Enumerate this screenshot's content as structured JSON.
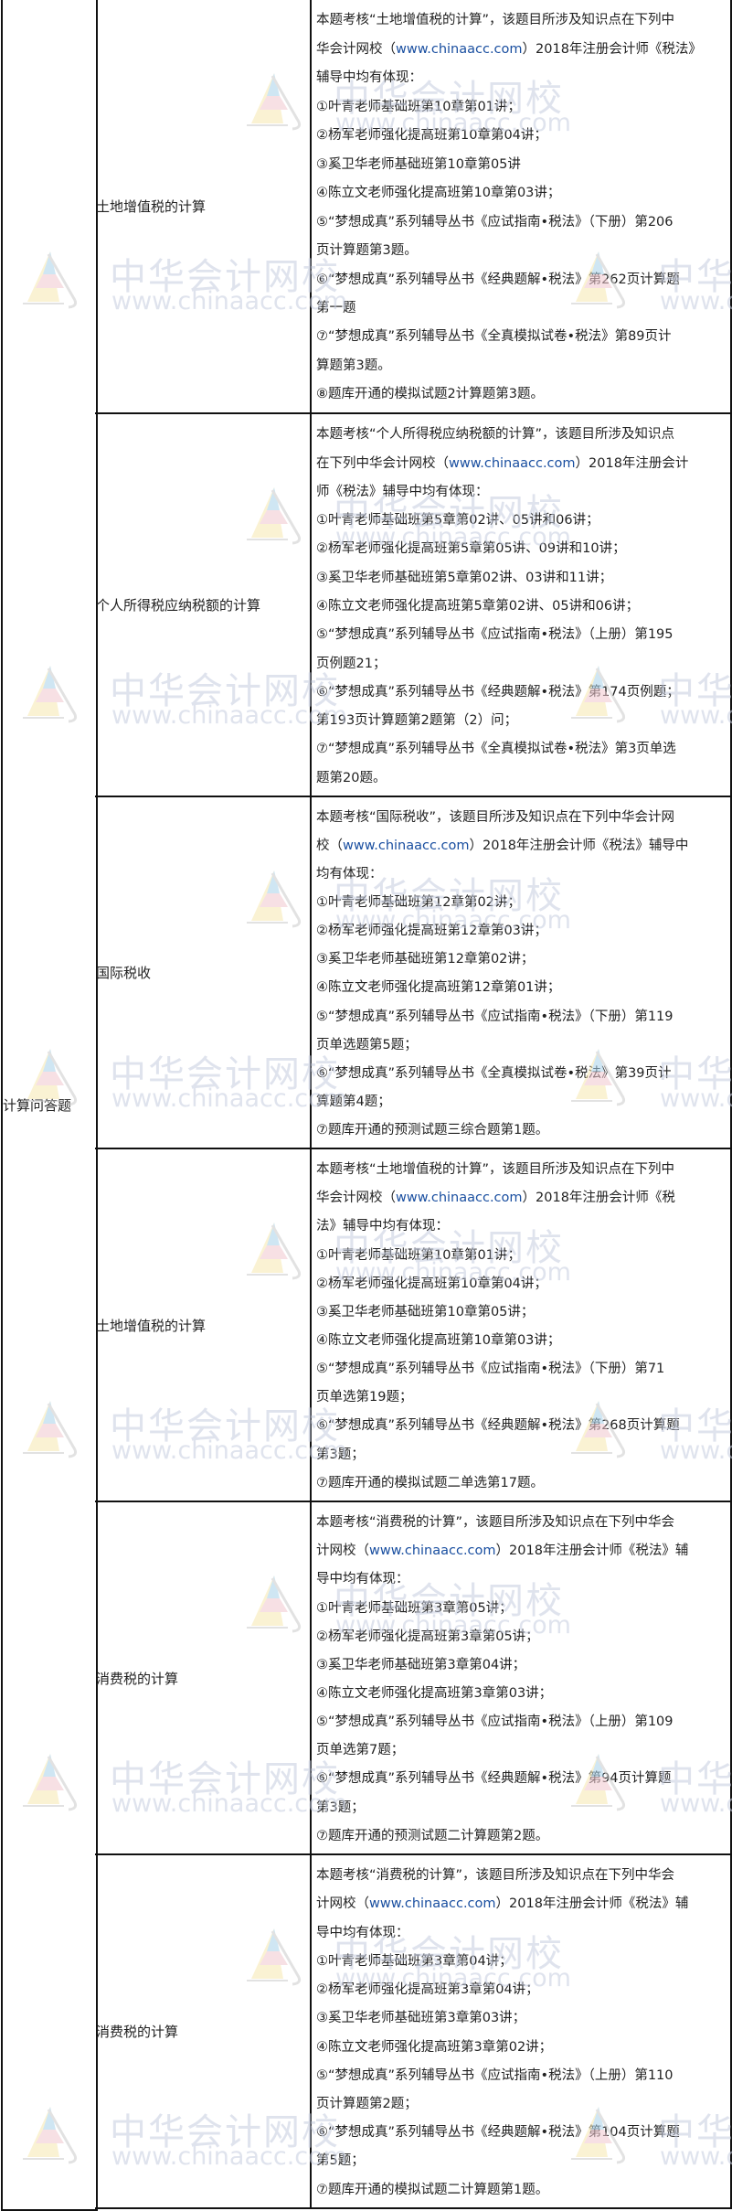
{
  "category": "计算问答题",
  "watermark": {
    "cn": "中华会计网校",
    "url": "www.chinaacc.com"
  },
  "colors": {
    "link": "#1a4fa0",
    "border": "#111111",
    "watermark": "#c6cde0"
  },
  "rows": [
    {
      "topic": "土地增值税的计算",
      "lines": [
        "本题考核“土地增值税的计算”，该题目所涉及知识点在下列中",
        {
          "pre": "华会计网校（",
          "link": "www.chinaacc.com",
          "post": "）2018年注册会计师《税法》"
        },
        "辅导中均有体现：",
        "①叶青老师基础班第10章第01讲；",
        "②杨军老师强化提高班第10章第04讲；",
        "③奚卫华老师基础班第10章第05讲",
        "④陈立文老师强化提高班第10章第03讲；",
        "⑤“梦想成真”系列辅导丛书《应试指南•税法》（下册）第206",
        "页计算题第3题。",
        "⑥“梦想成真”系列辅导丛书《经典题解•税法》第262页计算题",
        "第一题",
        "⑦“梦想成真”系列辅导丛书《全真模拟试卷•税法》第89页计",
        "算题第3题。",
        "⑧题库开通的模拟试题2计算题第3题。"
      ]
    },
    {
      "topic": "个人所得税应纳税额的计算",
      "lines": [
        "本题考核“个人所得税应纳税额的计算”，该题目所涉及知识点",
        {
          "pre": "在下列中华会计网校（",
          "link": "www.chinaacc.com",
          "post": "）2018年注册会计"
        },
        "师《税法》辅导中均有体现：",
        "①叶青老师基础班第5章第02讲、05讲和06讲；",
        "②杨军老师强化提高班第5章第05讲、09讲和10讲；",
        "③奚卫华老师基础班第5章第02讲、03讲和11讲；",
        "④陈立文老师强化提高班第5章第02讲、05讲和06讲；",
        "⑤“梦想成真”系列辅导丛书《应试指南•税法》（上册）第195",
        "页例题21；",
        "⑥“梦想成真”系列辅导丛书《经典题解•税法》第174页例题；",
        "第193页计算题第2题第（2）问；",
        "⑦“梦想成真”系列辅导丛书《全真模拟试卷•税法》第3页单选",
        "题第20题。"
      ]
    },
    {
      "topic": "国际税收",
      "lines": [
        "本题考核“国际税收”，该题目所涉及知识点在下列中华会计网",
        {
          "pre": "校（",
          "link": "www.chinaacc.com",
          "post": "）2018年注册会计师《税法》辅导中"
        },
        "均有体现：",
        "①叶青老师基础班第12章第02讲；",
        "②杨军老师强化提高班第12章第03讲；",
        "③奚卫华老师基础班第12章第02讲；",
        "④陈立文老师强化提高班第12章第01讲；",
        "⑤“梦想成真”系列辅导丛书《应试指南•税法》（下册）第119",
        "页单选题第5题；",
        "⑥“梦想成真”系列辅导丛书《全真模拟试卷•税法》第39页计",
        "算题第4题；",
        "⑦题库开通的预测试题三综合题第1题。"
      ]
    },
    {
      "topic": "土地增值税的计算",
      "lines": [
        "本题考核“土地增值税的计算”，该题目所涉及知识点在下列中",
        {
          "pre": "华会计网校（",
          "link": "www.chinaacc.com",
          "post": "）2018年注册会计师《税"
        },
        "法》辅导中均有体现：",
        "①叶青老师基础班第10章第01讲；",
        "②杨军老师强化提高班第10章第04讲；",
        "③奚卫华老师基础班第10章第05讲；",
        "④陈立文老师强化提高班第10章第03讲；",
        "⑤“梦想成真”系列辅导丛书《应试指南•税法》（下册）第71",
        "页单选第19题；",
        "⑥“梦想成真”系列辅导丛书《经典题解•税法》第268页计算题",
        "第3题；",
        "⑦题库开通的模拟试题二单选第17题。"
      ]
    },
    {
      "topic": "消费税的计算",
      "lines": [
        "本题考核“消费税的计算”，该题目所涉及知识点在下列中华会",
        {
          "pre": "计网校（",
          "link": "www.chinaacc.com",
          "post": "）2018年注册会计师《税法》辅"
        },
        "导中均有体现：",
        "①叶青老师基础班第3章第05讲；",
        "②杨军老师强化提高班第3章第05讲；",
        "③奚卫华老师基础班第3章第04讲；",
        "④陈立文老师强化提高班第3章第03讲；",
        "⑤“梦想成真”系列辅导丛书《应试指南•税法》（上册）第109",
        "页单选第7题；",
        "⑥“梦想成真”系列辅导丛书《经典题解•税法》第94页计算题",
        "第3题；",
        "⑦题库开通的预测试题二计算题第2题。"
      ]
    },
    {
      "topic": "消费税的计算",
      "lines": [
        "本题考核“消费税的计算”，该题目所涉及知识点在下列中华会",
        {
          "pre": "计网校（",
          "link": "www.chinaacc.com",
          "post": "）2018年注册会计师《税法》辅"
        },
        "导中均有体现：",
        "①叶青老师基础班第3章第04讲；",
        "②杨军老师强化提高班第3章第04讲；",
        "③奚卫华老师基础班第3章第03讲；",
        "④陈立文老师强化提高班第3章第02讲；",
        "⑤“梦想成真”系列辅导丛书《应试指南•税法》（上册）第110",
        "页计算题第2题；",
        "⑥“梦想成真”系列辅导丛书《经典题解•税法》第104页计算题",
        "第5题；",
        "⑦题库开通的模拟试题二计算题第1题。"
      ]
    }
  ]
}
